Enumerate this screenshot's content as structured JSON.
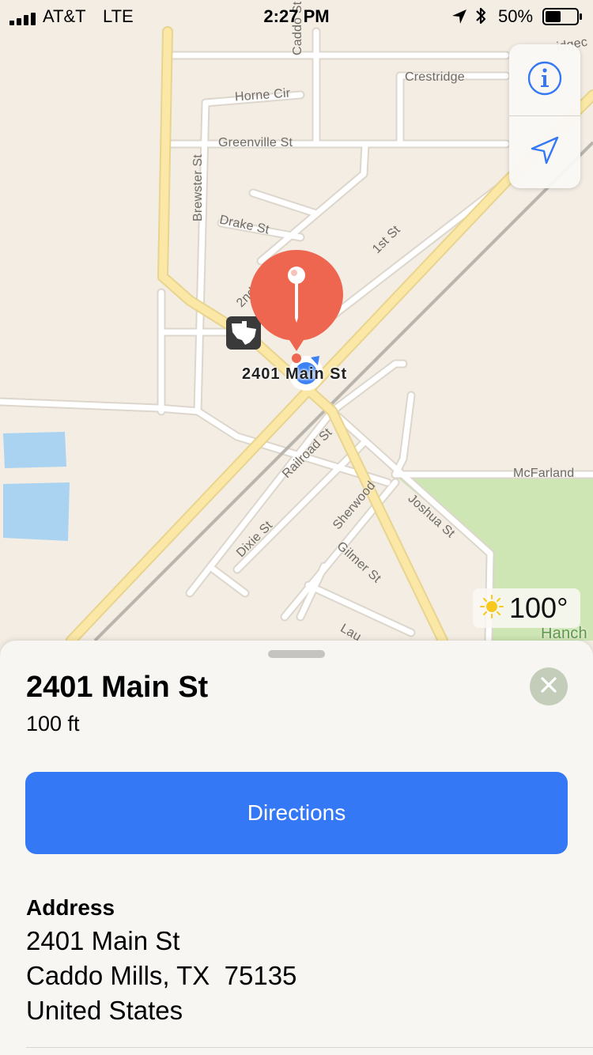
{
  "status_bar": {
    "carrier": "AT&T",
    "network": "LTE",
    "time": "2:27 PM",
    "battery_percent": "50%",
    "battery_level": 0.5,
    "signal_bars": 4,
    "icons": [
      "signal-bars-icon",
      "location-arrow-icon",
      "bluetooth-icon",
      "battery-icon"
    ]
  },
  "map": {
    "road_labels": {
      "caddo_st": "Caddo St",
      "crestridge": "Crestridge",
      "horne_cir": "Horne Cir",
      "greenville_st": "Greenville St",
      "brewster_st": "Brewster St",
      "drake_st": "Drake St",
      "first_st": "1st St",
      "second_st": "2nd",
      "railroad_st": "Railroad St",
      "mcfarland": "McFarland",
      "sherwood": "Sherwood",
      "joshua_st": "Joshua St",
      "dixie_st": "Dixie St",
      "gilmer_st": "Gilmer St",
      "lau": "Lau",
      "edge_top_right": "idgec",
      "hanch": "Hanch"
    },
    "highway_shield": "36",
    "pin_label": "2401 Main St",
    "colors": {
      "land": "#f3ede4",
      "road": "#ffffff",
      "road_casing": "#dcd6cc",
      "highway": "#fbe8a6",
      "water": "#a9d3f0",
      "park": "#cde6b4",
      "pin": "#ee6650",
      "user_location": "#3d82f5"
    }
  },
  "map_controls": {
    "info_icon": "info-icon",
    "tracking_icon": "location-arrow-icon",
    "accent": "#3478f6"
  },
  "weather": {
    "temperature": "100°",
    "icon": "sun-icon"
  },
  "place_card": {
    "title": "2401 Main St",
    "distance": "100 ft",
    "directions_label": "Directions",
    "address_heading": "Address",
    "address_line1": "2401 Main St",
    "address_line2": "Caddo Mills, TX  75135",
    "address_line3": "United States",
    "close_icon": "close-icon"
  }
}
